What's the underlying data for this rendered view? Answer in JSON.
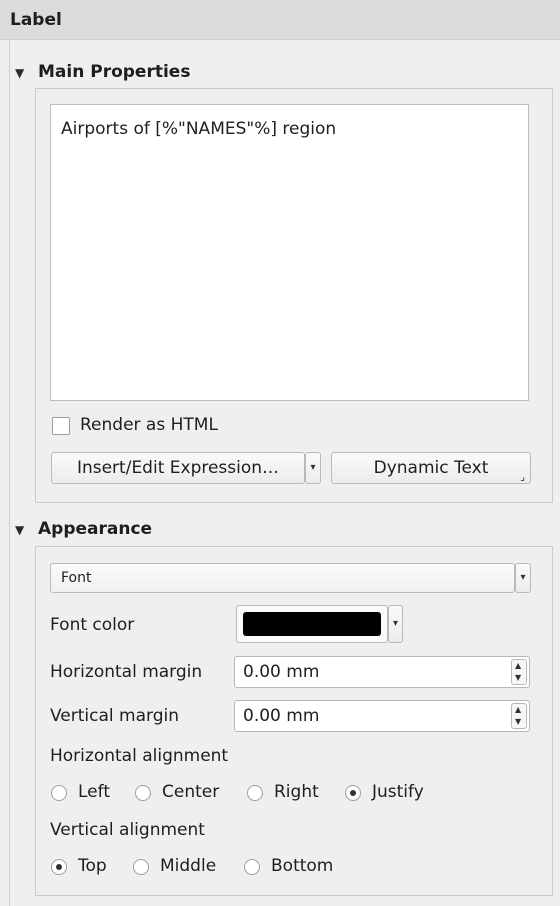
{
  "panel_title": "Label",
  "main_properties": {
    "heading": "Main Properties",
    "label_text": "Airports of [%\"NAMES\"%] region",
    "render_html_label": "Render as HTML",
    "render_html_checked": false,
    "insert_expression_label": "Insert/Edit Expression…",
    "dynamic_text_label": "Dynamic Text"
  },
  "appearance": {
    "heading": "Appearance",
    "font_combo_value": "Font",
    "font_color_label": "Font color",
    "font_color_value": "#000000",
    "horizontal_margin_label": "Horizontal margin",
    "horizontal_margin_value": "0.00 mm",
    "vertical_margin_label": "Vertical margin",
    "vertical_margin_value": "0.00 mm",
    "horizontal_alignment_label": "Horizontal alignment",
    "horizontal_options": [
      "Left",
      "Center",
      "Right",
      "Justify"
    ],
    "horizontal_selected": "Justify",
    "vertical_alignment_label": "Vertical alignment",
    "vertical_options": [
      "Top",
      "Middle",
      "Bottom"
    ],
    "vertical_selected": "Top"
  }
}
